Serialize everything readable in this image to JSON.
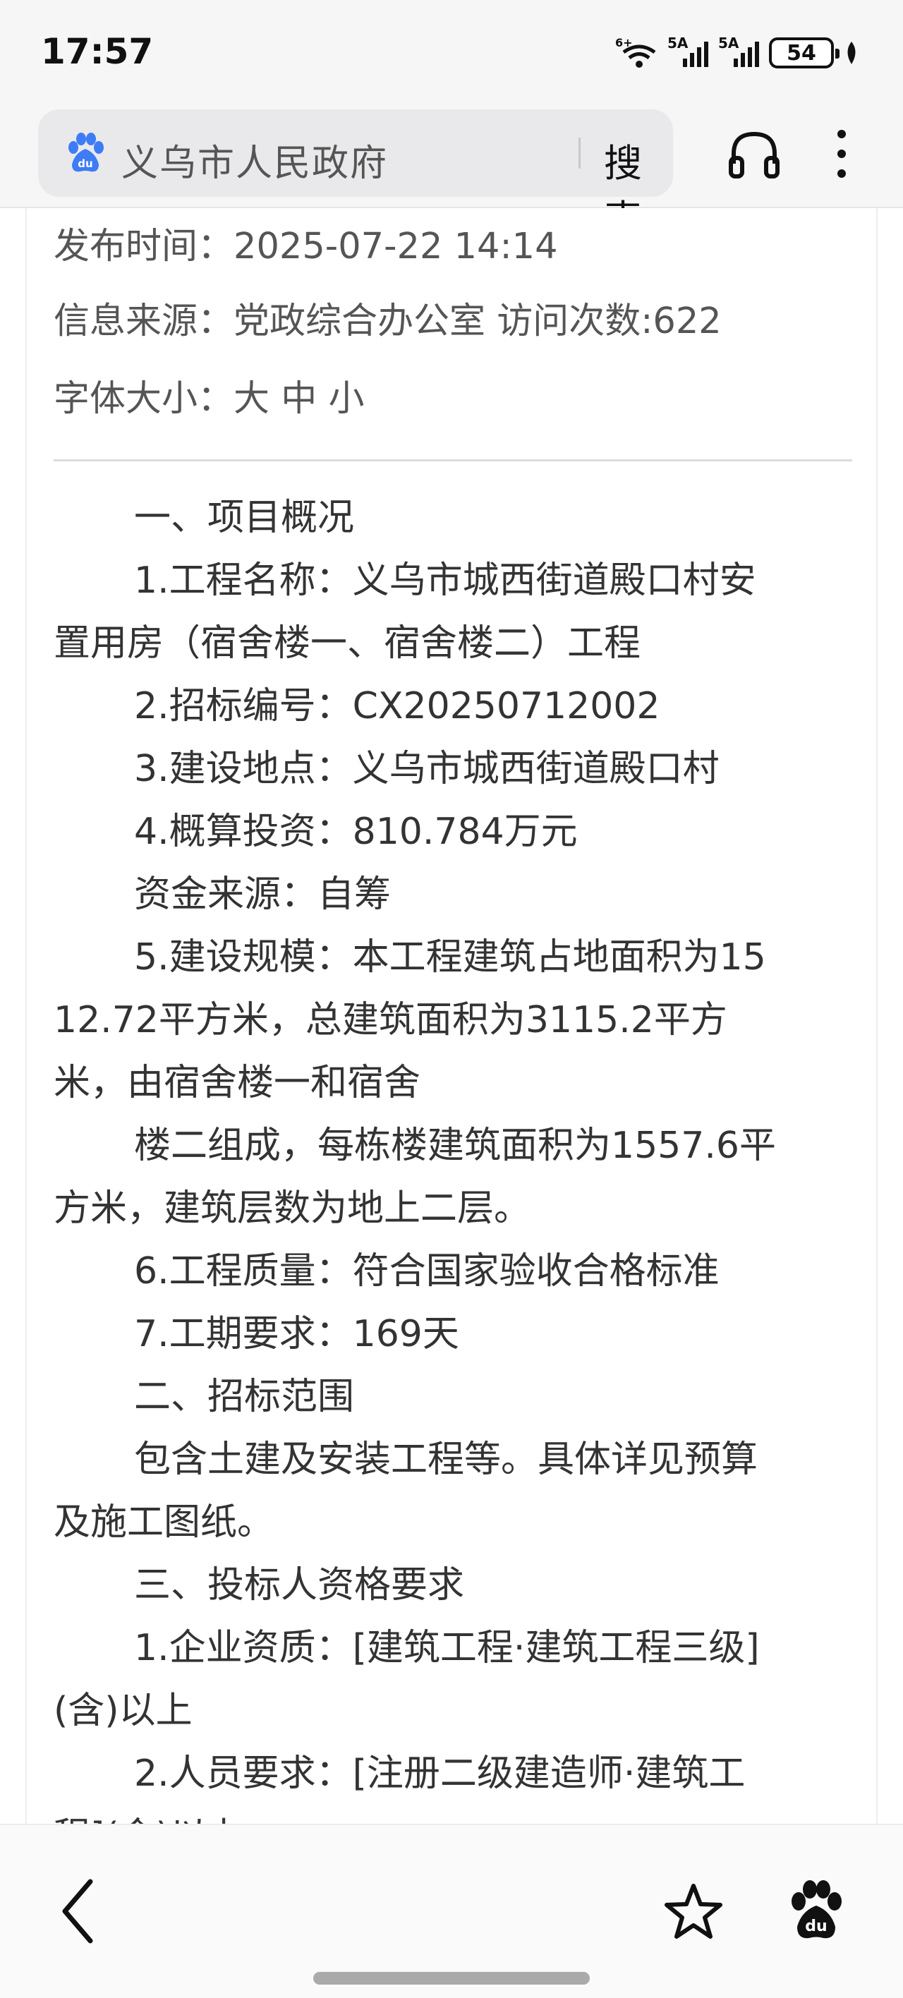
{
  "status_bar": {
    "time": "17:57",
    "wifi_label": "6+",
    "signal1_label": "5A",
    "signal2_label": "5A",
    "battery": "54"
  },
  "header": {
    "search_text": "义乌市人民政府",
    "search_button": "搜索",
    "icons": [
      "baidu-paw-icon",
      "headset-icon",
      "more-icon"
    ]
  },
  "meta": {
    "publish_time": "发布时间：2025-07-22 14:14",
    "source": "信息来源：党政综合办公室   访问次数:622",
    "font_size_label": "字体大小：",
    "font_sizes": [
      "大",
      "中",
      "小"
    ]
  },
  "content_lines": [
    {
      "text": "一、项目概况",
      "indent": true
    },
    {
      "text": "1.工程名称：义乌市城西街道殿口村安",
      "indent": true
    },
    {
      "text": "置用房（宿舍楼一、宿舍楼二）工程",
      "indent": false
    },
    {
      "text": "2.招标编号：CX20250712002",
      "indent": true
    },
    {
      "text": "3.建设地点：义乌市城西街道殿口村",
      "indent": true
    },
    {
      "text": "4.概算投资：810.784万元",
      "indent": true
    },
    {
      "text": "资金来源：自筹",
      "indent": true
    },
    {
      "text": "5.建设规模：本工程建筑占地面积为15",
      "indent": true
    },
    {
      "text": "12.72平方米，总建筑面积为3115.2平方",
      "indent": false
    },
    {
      "text": "米，由宿舍楼一和宿舍",
      "indent": false
    },
    {
      "text": "楼二组成，每栋楼建筑面积为1557.6平",
      "indent": true
    },
    {
      "text": "方米，建筑层数为地上二层。",
      "indent": false
    },
    {
      "text": "6.工程质量：符合国家验收合格标准",
      "indent": true
    },
    {
      "text": "7.工期要求：169天",
      "indent": true
    },
    {
      "text": "二、招标范围",
      "indent": true
    },
    {
      "text": "包含土建及安装工程等。具体详见预算",
      "indent": true
    },
    {
      "text": "及施工图纸。",
      "indent": false
    },
    {
      "text": "三、投标人资格要求",
      "indent": true
    },
    {
      "text": "1.企业资质：[建筑工程·建筑工程三级]",
      "indent": true
    },
    {
      "text": "(含)以上",
      "indent": false
    },
    {
      "text": "2.人员要求：[注册二级建造师·建筑工",
      "indent": true
    },
    {
      "text": "程](含)以上",
      "indent": false
    }
  ],
  "bottom_bar": {
    "icons": [
      "back-icon",
      "star-icon",
      "baidu-paw-icon"
    ]
  }
}
